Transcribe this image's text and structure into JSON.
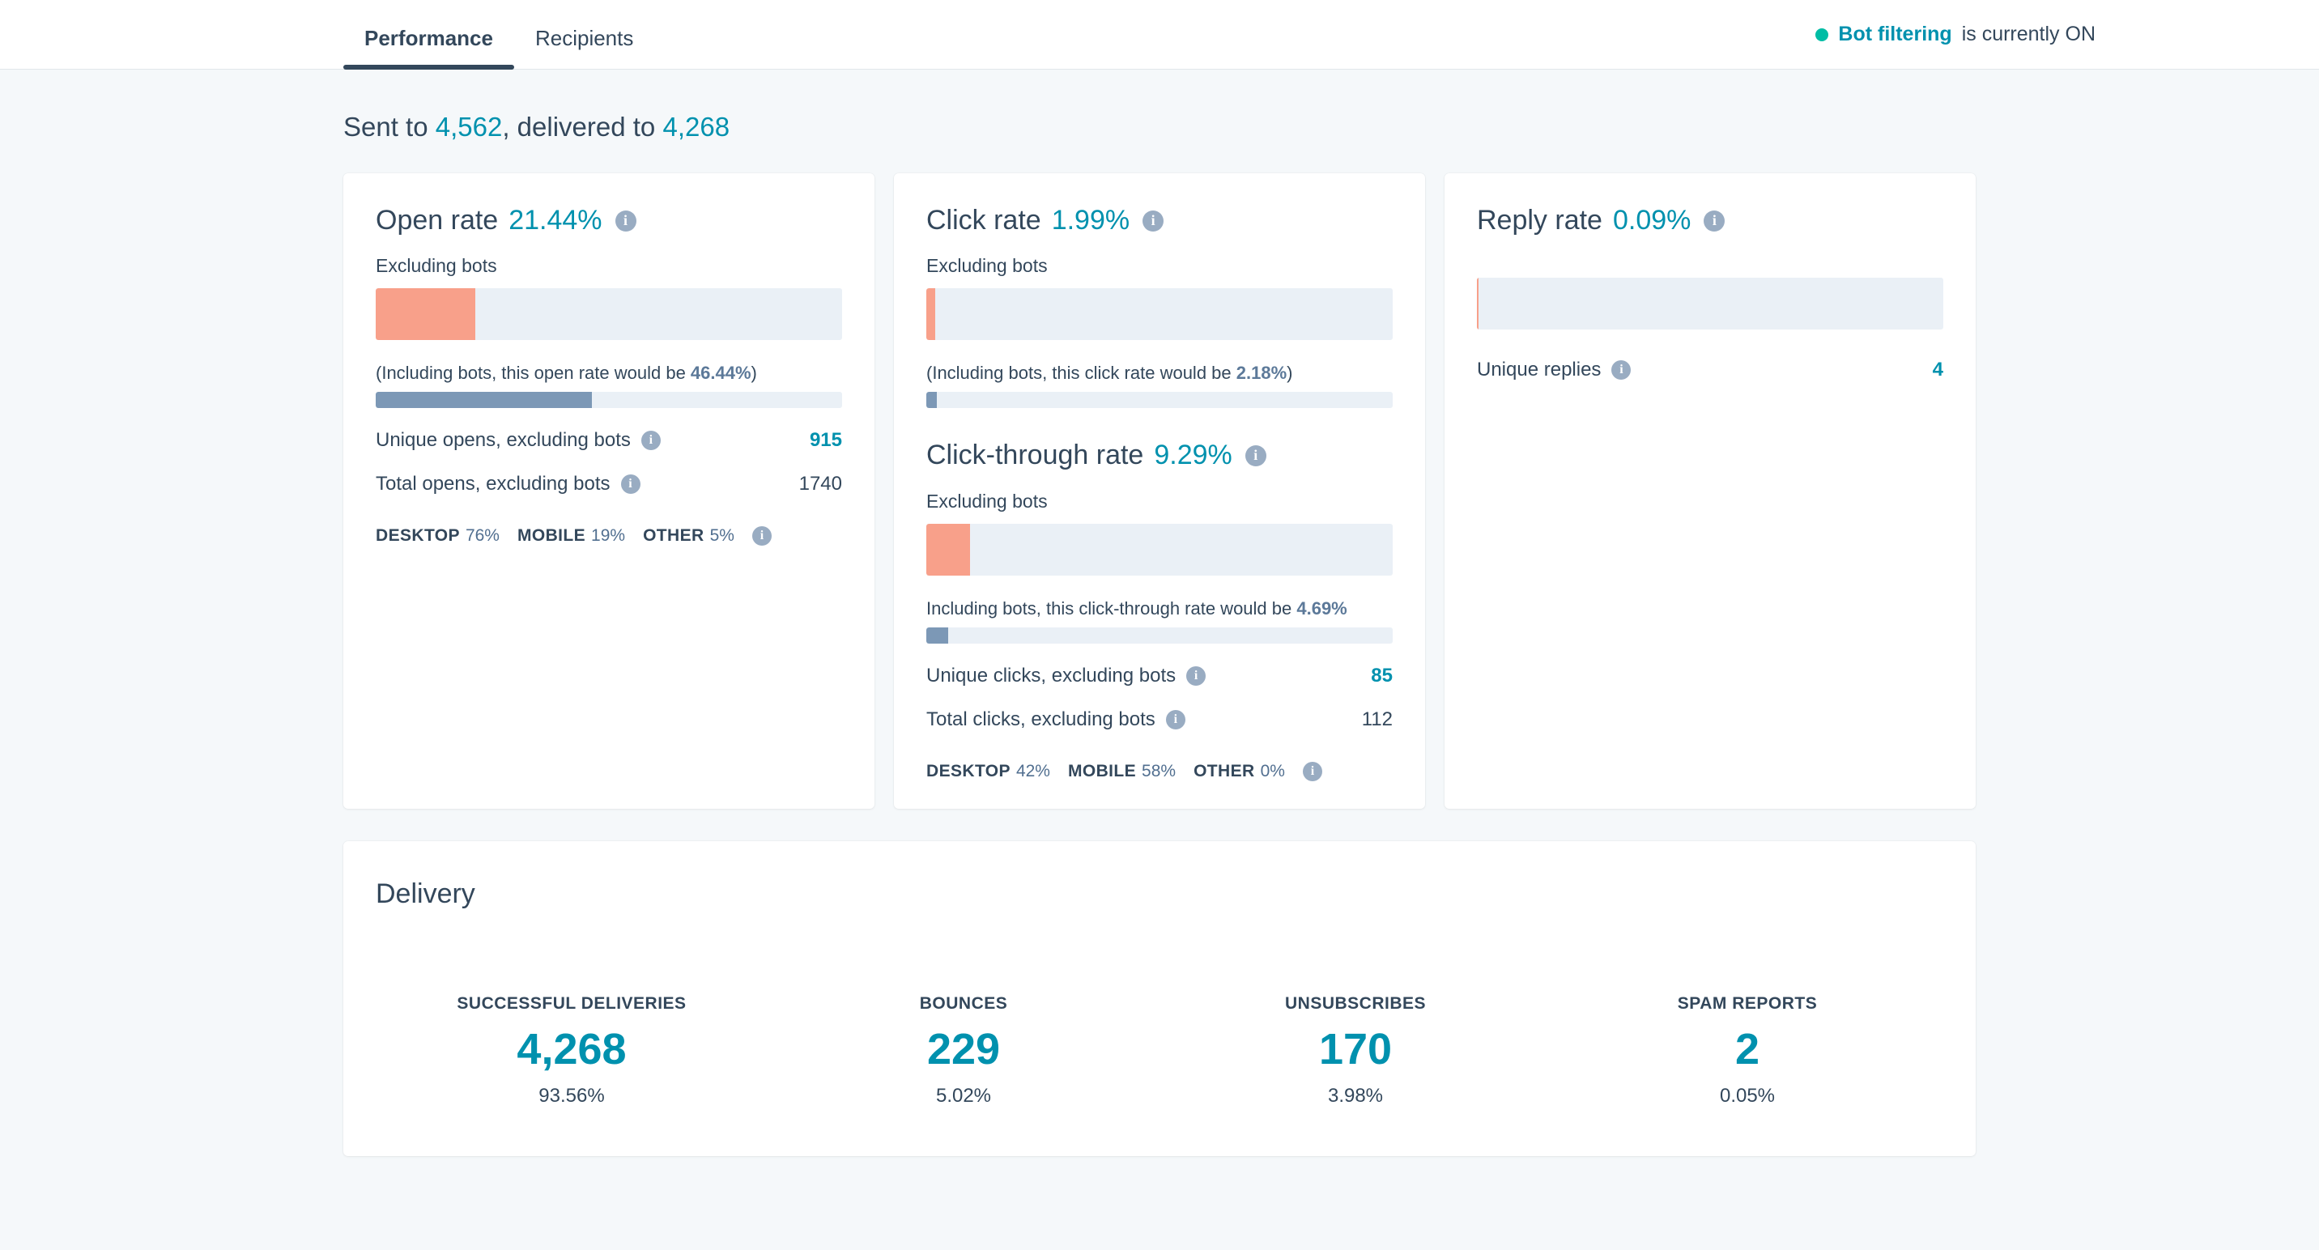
{
  "nav": {
    "tabs": [
      {
        "label": "Performance",
        "active": true
      },
      {
        "label": "Recipients",
        "active": false
      }
    ],
    "bot_filter": {
      "strong": "Bot filtering",
      "rest": " is currently ON",
      "dot_color": "#00bda5"
    }
  },
  "summary": {
    "prefix": "Sent to ",
    "sent": "4,562",
    "middle": ", delivered to ",
    "delivered": "4,268"
  },
  "colors": {
    "teal": "#0091ae",
    "orange": "#f8a08a",
    "slate": "#7c98b6",
    "track": "#eaf0f6",
    "dark": "#33475b"
  },
  "open_card": {
    "title": "Open rate",
    "rate": "21.44%",
    "rate_pct": 21.44,
    "excluding_label": "Excluding bots",
    "including_text_before": "(Including bots, this open rate would be ",
    "including_value": "46.44%",
    "including_text_after": ")",
    "including_pct": 46.44,
    "stats": [
      {
        "label": "Unique opens, excluding bots",
        "value": "915",
        "accent": true
      },
      {
        "label": "Total opens, excluding bots",
        "value": "1740",
        "accent": false
      }
    ],
    "devices": [
      {
        "name": "DESKTOP",
        "pct": "76%"
      },
      {
        "name": "MOBILE",
        "pct": "19%"
      },
      {
        "name": "OTHER",
        "pct": "5%"
      }
    ]
  },
  "click_card": {
    "title": "Click rate",
    "rate": "1.99%",
    "rate_pct": 1.99,
    "excluding_label": "Excluding bots",
    "including_text_before": "(Including bots, this click rate would be ",
    "including_value": "2.18%",
    "including_text_after": ")",
    "including_pct": 2.18
  },
  "ctr_card": {
    "title": "Click-through rate",
    "rate": "9.29%",
    "rate_pct": 9.29,
    "excluding_label": "Excluding bots",
    "including_text_before": "Including bots, this click-through rate would be ",
    "including_value": "4.69%",
    "including_text_after": "",
    "including_pct": 4.69,
    "stats": [
      {
        "label": "Unique clicks, excluding bots",
        "value": "85",
        "accent": true
      },
      {
        "label": "Total clicks, excluding bots",
        "value": "112",
        "accent": false
      }
    ],
    "devices": [
      {
        "name": "DESKTOP",
        "pct": "42%"
      },
      {
        "name": "MOBILE",
        "pct": "58%"
      },
      {
        "name": "OTHER",
        "pct": "0%"
      }
    ]
  },
  "reply_card": {
    "title": "Reply rate",
    "rate": "0.09%",
    "rate_pct": 0.3,
    "stats": [
      {
        "label": "Unique replies",
        "value": "4",
        "accent": true
      }
    ]
  },
  "delivery": {
    "title": "Delivery",
    "metrics": [
      {
        "label": "SUCCESSFUL DELIVERIES",
        "value": "4,268",
        "pct": "93.56%"
      },
      {
        "label": "BOUNCES",
        "value": "229",
        "pct": "5.02%"
      },
      {
        "label": "UNSUBSCRIBES",
        "value": "170",
        "pct": "3.98%"
      },
      {
        "label": "SPAM REPORTS",
        "value": "2",
        "pct": "0.05%"
      }
    ]
  },
  "icons": {
    "info": "i"
  }
}
